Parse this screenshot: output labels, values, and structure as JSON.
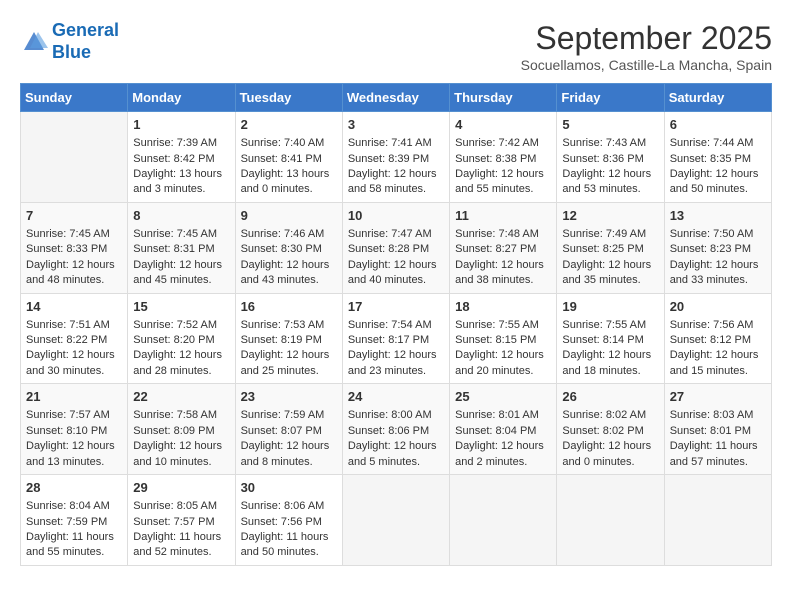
{
  "header": {
    "logo_line1": "General",
    "logo_line2": "Blue",
    "month_title": "September 2025",
    "location": "Socuellamos, Castille-La Mancha, Spain"
  },
  "days_of_week": [
    "Sunday",
    "Monday",
    "Tuesday",
    "Wednesday",
    "Thursday",
    "Friday",
    "Saturday"
  ],
  "weeks": [
    [
      {
        "day": "",
        "sunrise": "",
        "sunset": "",
        "daylight": ""
      },
      {
        "day": "1",
        "sunrise": "Sunrise: 7:39 AM",
        "sunset": "Sunset: 8:42 PM",
        "daylight": "Daylight: 13 hours and 3 minutes."
      },
      {
        "day": "2",
        "sunrise": "Sunrise: 7:40 AM",
        "sunset": "Sunset: 8:41 PM",
        "daylight": "Daylight: 13 hours and 0 minutes."
      },
      {
        "day": "3",
        "sunrise": "Sunrise: 7:41 AM",
        "sunset": "Sunset: 8:39 PM",
        "daylight": "Daylight: 12 hours and 58 minutes."
      },
      {
        "day": "4",
        "sunrise": "Sunrise: 7:42 AM",
        "sunset": "Sunset: 8:38 PM",
        "daylight": "Daylight: 12 hours and 55 minutes."
      },
      {
        "day": "5",
        "sunrise": "Sunrise: 7:43 AM",
        "sunset": "Sunset: 8:36 PM",
        "daylight": "Daylight: 12 hours and 53 minutes."
      },
      {
        "day": "6",
        "sunrise": "Sunrise: 7:44 AM",
        "sunset": "Sunset: 8:35 PM",
        "daylight": "Daylight: 12 hours and 50 minutes."
      }
    ],
    [
      {
        "day": "7",
        "sunrise": "Sunrise: 7:45 AM",
        "sunset": "Sunset: 8:33 PM",
        "daylight": "Daylight: 12 hours and 48 minutes."
      },
      {
        "day": "8",
        "sunrise": "Sunrise: 7:45 AM",
        "sunset": "Sunset: 8:31 PM",
        "daylight": "Daylight: 12 hours and 45 minutes."
      },
      {
        "day": "9",
        "sunrise": "Sunrise: 7:46 AM",
        "sunset": "Sunset: 8:30 PM",
        "daylight": "Daylight: 12 hours and 43 minutes."
      },
      {
        "day": "10",
        "sunrise": "Sunrise: 7:47 AM",
        "sunset": "Sunset: 8:28 PM",
        "daylight": "Daylight: 12 hours and 40 minutes."
      },
      {
        "day": "11",
        "sunrise": "Sunrise: 7:48 AM",
        "sunset": "Sunset: 8:27 PM",
        "daylight": "Daylight: 12 hours and 38 minutes."
      },
      {
        "day": "12",
        "sunrise": "Sunrise: 7:49 AM",
        "sunset": "Sunset: 8:25 PM",
        "daylight": "Daylight: 12 hours and 35 minutes."
      },
      {
        "day": "13",
        "sunrise": "Sunrise: 7:50 AM",
        "sunset": "Sunset: 8:23 PM",
        "daylight": "Daylight: 12 hours and 33 minutes."
      }
    ],
    [
      {
        "day": "14",
        "sunrise": "Sunrise: 7:51 AM",
        "sunset": "Sunset: 8:22 PM",
        "daylight": "Daylight: 12 hours and 30 minutes."
      },
      {
        "day": "15",
        "sunrise": "Sunrise: 7:52 AM",
        "sunset": "Sunset: 8:20 PM",
        "daylight": "Daylight: 12 hours and 28 minutes."
      },
      {
        "day": "16",
        "sunrise": "Sunrise: 7:53 AM",
        "sunset": "Sunset: 8:19 PM",
        "daylight": "Daylight: 12 hours and 25 minutes."
      },
      {
        "day": "17",
        "sunrise": "Sunrise: 7:54 AM",
        "sunset": "Sunset: 8:17 PM",
        "daylight": "Daylight: 12 hours and 23 minutes."
      },
      {
        "day": "18",
        "sunrise": "Sunrise: 7:55 AM",
        "sunset": "Sunset: 8:15 PM",
        "daylight": "Daylight: 12 hours and 20 minutes."
      },
      {
        "day": "19",
        "sunrise": "Sunrise: 7:55 AM",
        "sunset": "Sunset: 8:14 PM",
        "daylight": "Daylight: 12 hours and 18 minutes."
      },
      {
        "day": "20",
        "sunrise": "Sunrise: 7:56 AM",
        "sunset": "Sunset: 8:12 PM",
        "daylight": "Daylight: 12 hours and 15 minutes."
      }
    ],
    [
      {
        "day": "21",
        "sunrise": "Sunrise: 7:57 AM",
        "sunset": "Sunset: 8:10 PM",
        "daylight": "Daylight: 12 hours and 13 minutes."
      },
      {
        "day": "22",
        "sunrise": "Sunrise: 7:58 AM",
        "sunset": "Sunset: 8:09 PM",
        "daylight": "Daylight: 12 hours and 10 minutes."
      },
      {
        "day": "23",
        "sunrise": "Sunrise: 7:59 AM",
        "sunset": "Sunset: 8:07 PM",
        "daylight": "Daylight: 12 hours and 8 minutes."
      },
      {
        "day": "24",
        "sunrise": "Sunrise: 8:00 AM",
        "sunset": "Sunset: 8:06 PM",
        "daylight": "Daylight: 12 hours and 5 minutes."
      },
      {
        "day": "25",
        "sunrise": "Sunrise: 8:01 AM",
        "sunset": "Sunset: 8:04 PM",
        "daylight": "Daylight: 12 hours and 2 minutes."
      },
      {
        "day": "26",
        "sunrise": "Sunrise: 8:02 AM",
        "sunset": "Sunset: 8:02 PM",
        "daylight": "Daylight: 12 hours and 0 minutes."
      },
      {
        "day": "27",
        "sunrise": "Sunrise: 8:03 AM",
        "sunset": "Sunset: 8:01 PM",
        "daylight": "Daylight: 11 hours and 57 minutes."
      }
    ],
    [
      {
        "day": "28",
        "sunrise": "Sunrise: 8:04 AM",
        "sunset": "Sunset: 7:59 PM",
        "daylight": "Daylight: 11 hours and 55 minutes."
      },
      {
        "day": "29",
        "sunrise": "Sunrise: 8:05 AM",
        "sunset": "Sunset: 7:57 PM",
        "daylight": "Daylight: 11 hours and 52 minutes."
      },
      {
        "day": "30",
        "sunrise": "Sunrise: 8:06 AM",
        "sunset": "Sunset: 7:56 PM",
        "daylight": "Daylight: 11 hours and 50 minutes."
      },
      {
        "day": "",
        "sunrise": "",
        "sunset": "",
        "daylight": ""
      },
      {
        "day": "",
        "sunrise": "",
        "sunset": "",
        "daylight": ""
      },
      {
        "day": "",
        "sunrise": "",
        "sunset": "",
        "daylight": ""
      },
      {
        "day": "",
        "sunrise": "",
        "sunset": "",
        "daylight": ""
      }
    ]
  ]
}
